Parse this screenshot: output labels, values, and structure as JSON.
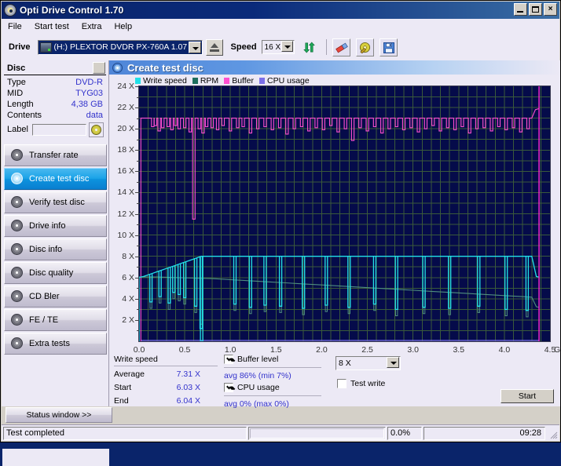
{
  "window": {
    "title": "Opti Drive Control 1.70",
    "icon": "disc-icon",
    "minimize": "minimize-icon",
    "maximize": "maximize-icon",
    "close": "×"
  },
  "menu": {
    "items": [
      "File",
      "Start test",
      "Extra",
      "Help"
    ]
  },
  "toolbar": {
    "drive_label": "Drive",
    "drive_value": "(H:)   PLEXTOR DVDR   PX-760A 1.07",
    "eject_icon": "eject-icon",
    "speed_label": "Speed",
    "speed_value": "16 X",
    "refresh_icon": "refresh-icon",
    "erase_icon": "eraser-icon",
    "disc_label_icon": "disc-label-icon",
    "save_icon": "save-icon"
  },
  "disc": {
    "header": "Disc",
    "rows": [
      {
        "key": "Type",
        "value": "DVD-R"
      },
      {
        "key": "MID",
        "value": "TYG03"
      },
      {
        "key": "Length",
        "value": "4,38 GB"
      },
      {
        "key": "Contents",
        "value": "data"
      }
    ],
    "label_key": "Label",
    "label_value": "",
    "label_placeholder": "",
    "label_button_icon": "cd-icon"
  },
  "nav": {
    "items": [
      {
        "label": "Transfer rate",
        "icon": "transfer-rate-icon",
        "active": false
      },
      {
        "label": "Create test disc",
        "icon": "create-test-disc-icon",
        "active": true
      },
      {
        "label": "Verify test disc",
        "icon": "verify-test-disc-icon",
        "active": false
      },
      {
        "label": "Drive info",
        "icon": "drive-info-icon",
        "active": false
      },
      {
        "label": "Disc info",
        "icon": "disc-info-icon",
        "active": false
      },
      {
        "label": "Disc quality",
        "icon": "disc-quality-icon",
        "active": false
      },
      {
        "label": "CD Bler",
        "icon": "cd-bler-icon",
        "active": false
      },
      {
        "label": "FE / TE",
        "icon": "fe-te-icon",
        "active": false
      },
      {
        "label": "Extra tests",
        "icon": "extra-tests-icon",
        "active": false
      }
    ],
    "status_window": "Status window >>"
  },
  "panel": {
    "title": "Create test disc",
    "icon": "create-test-disc-icon"
  },
  "chart_data": {
    "type": "line",
    "title": "Create test disc",
    "xlabel": "GB",
    "ylabel": "X",
    "xlim": [
      0.0,
      4.5
    ],
    "ylim": [
      0,
      24
    ],
    "grid": true,
    "legend_position": "top-left",
    "xticks": [
      "0.0",
      "0.5",
      "1.0",
      "1.5",
      "2.0",
      "2.5",
      "3.0",
      "3.5",
      "4.0",
      "4.5"
    ],
    "xtick_values": [
      0.0,
      0.5,
      1.0,
      1.5,
      2.0,
      2.5,
      3.0,
      3.5,
      4.0,
      4.5
    ],
    "x_unit": "GB",
    "yticks": [
      "2 X",
      "4 X",
      "6 X",
      "8 X",
      "10 X",
      "12 X",
      "14 X",
      "16 X",
      "18 X",
      "20 X",
      "22 X",
      "24 X"
    ],
    "ytick_values": [
      2,
      4,
      6,
      8,
      10,
      12,
      14,
      16,
      18,
      20,
      22,
      24
    ],
    "legend": [
      {
        "name": "Write speed",
        "color": "#22e0e8"
      },
      {
        "name": "RPM",
        "color": "#1f6e5e"
      },
      {
        "name": "Buffer",
        "color": "#ff4fd0"
      },
      {
        "name": "CPU usage",
        "color": "#7b6fe8"
      }
    ],
    "plot_bg": "#050b4a",
    "grid_color": "#3a5a3a",
    "end_marker_x": 4.38,
    "end_marker_color": "#ff2ad0",
    "series": [
      {
        "name": "Write speed",
        "color": "#22e0e8",
        "x": [
          0.0,
          0.02,
          0.05,
          0.1,
          0.15,
          0.2,
          0.25,
          0.3,
          0.35,
          0.4,
          0.45,
          0.5,
          0.55,
          0.6,
          0.65,
          0.68,
          0.7,
          0.75,
          0.8,
          1.0,
          1.2,
          1.4,
          1.6,
          1.8,
          2.0,
          2.2,
          2.4,
          2.6,
          2.8,
          3.0,
          3.2,
          3.4,
          3.6,
          3.8,
          4.0,
          4.2,
          4.3,
          4.35,
          4.38
        ],
        "y": [
          6.03,
          6.05,
          6.1,
          6.25,
          6.4,
          6.55,
          6.7,
          6.85,
          7.0,
          7.15,
          7.3,
          7.45,
          7.6,
          7.75,
          7.9,
          8.0,
          8.0,
          8.0,
          8.0,
          8.0,
          8.0,
          8.0,
          8.0,
          8.0,
          8.0,
          8.0,
          8.0,
          8.0,
          8.0,
          8.0,
          8.0,
          8.0,
          8.0,
          8.0,
          8.0,
          8.0,
          8.0,
          6.1,
          6.04
        ],
        "dips_x": [
          0.13,
          0.23,
          0.33,
          0.38,
          0.44,
          0.5,
          0.62,
          0.68,
          1.05,
          1.22,
          1.38,
          1.55,
          1.8,
          2.05,
          2.3,
          2.58,
          2.82,
          3.12,
          3.4,
          3.72,
          4.02,
          4.25
        ],
        "dips_y": [
          3.7,
          4.2,
          3.6,
          4.6,
          4.4,
          4.1,
          3.3,
          1.2,
          3.5,
          3.2,
          3.4,
          3.3,
          3.1,
          3.4,
          3.2,
          3.5,
          3.0,
          3.2,
          3.1,
          3.3,
          3.0,
          2.9
        ]
      },
      {
        "name": "RPM",
        "color": "#4f8f7f",
        "x": [
          0.0,
          0.2,
          0.4,
          0.6,
          0.8,
          1.0,
          1.2,
          1.4,
          1.6,
          1.8,
          2.0,
          2.2,
          2.4,
          2.6,
          2.8,
          3.0,
          3.2,
          3.4,
          3.6,
          3.8,
          4.0,
          4.2,
          4.3,
          4.35,
          4.38
        ],
        "y": [
          6.05,
          6.05,
          6.0,
          5.95,
          5.9,
          5.8,
          5.7,
          5.6,
          5.5,
          5.4,
          5.3,
          5.2,
          5.1,
          5.0,
          4.9,
          4.8,
          4.7,
          4.6,
          4.5,
          4.4,
          4.3,
          4.2,
          4.15,
          3.25,
          3.2
        ]
      },
      {
        "name": "Buffer",
        "color": "#ff4fd0",
        "baseline": 21.0,
        "start_x": 0.02,
        "avg": "86%",
        "min": "7%",
        "dips_x": [
          0.15,
          0.18,
          0.22,
          0.26,
          0.32,
          0.36,
          0.4,
          0.44,
          0.5,
          0.56,
          0.6,
          0.66,
          0.7,
          0.74,
          0.8,
          0.86,
          0.92,
          1.0,
          1.08,
          1.14,
          1.22,
          1.3,
          1.38,
          1.46,
          1.54,
          1.62,
          1.7,
          1.78,
          1.86,
          1.94,
          2.02,
          2.1,
          2.18,
          2.26,
          2.34,
          2.42,
          2.5,
          2.58,
          2.66,
          2.74,
          2.82,
          2.9,
          2.98,
          3.06,
          3.14,
          3.22,
          3.3,
          3.38,
          3.46,
          3.54,
          3.62,
          3.7,
          3.78,
          3.86,
          3.94,
          4.02,
          4.1,
          4.18,
          4.26
        ],
        "dips_y": [
          20.2,
          20.3,
          19.8,
          20.1,
          20.2,
          19.9,
          20.3,
          20.0,
          20.1,
          19.7,
          11.5,
          20.0,
          19.6,
          20.2,
          20.1,
          19.9,
          20.3,
          19.8,
          20.1,
          20.2,
          19.6,
          20.0,
          20.2,
          19.9,
          20.1,
          19.5,
          20.0,
          20.2,
          19.8,
          20.1,
          19.9,
          20.3,
          19.7,
          20.0,
          18.9,
          20.1,
          19.8,
          20.2,
          19.6,
          20.0,
          20.2,
          19.9,
          20.1,
          19.7,
          20.0,
          20.3,
          19.8,
          20.1,
          19.9,
          20.2,
          19.6,
          20.0,
          20.1,
          19.8,
          20.2,
          19.9,
          20.1,
          19.7,
          20.0
        ]
      },
      {
        "name": "CPU usage",
        "color": "#7b6fe8",
        "avg": "0%",
        "max": "0%",
        "values_all_zero": true
      }
    ]
  },
  "stats": {
    "write_speed_title": "Write speed",
    "rows": [
      {
        "key": "Average",
        "value": "7.31 X"
      },
      {
        "key": "Start",
        "value": "6.03 X"
      },
      {
        "key": "End",
        "value": "6.04 X"
      }
    ],
    "buffer_level_label": "Buffer level",
    "buffer_level_checked": true,
    "buffer_level_value": "avg 86% (min 7%)",
    "cpu_usage_label": "CPU usage",
    "cpu_usage_checked": true,
    "cpu_usage_value": "avg 0% (max 0%)",
    "speed_select_value": "8 X",
    "test_write_label": "Test write",
    "test_write_checked": false,
    "start_button": "Start"
  },
  "statusbar": {
    "message": "Test completed",
    "progress_percent": "0.0%",
    "progress_value": 0,
    "time": "09:28"
  }
}
